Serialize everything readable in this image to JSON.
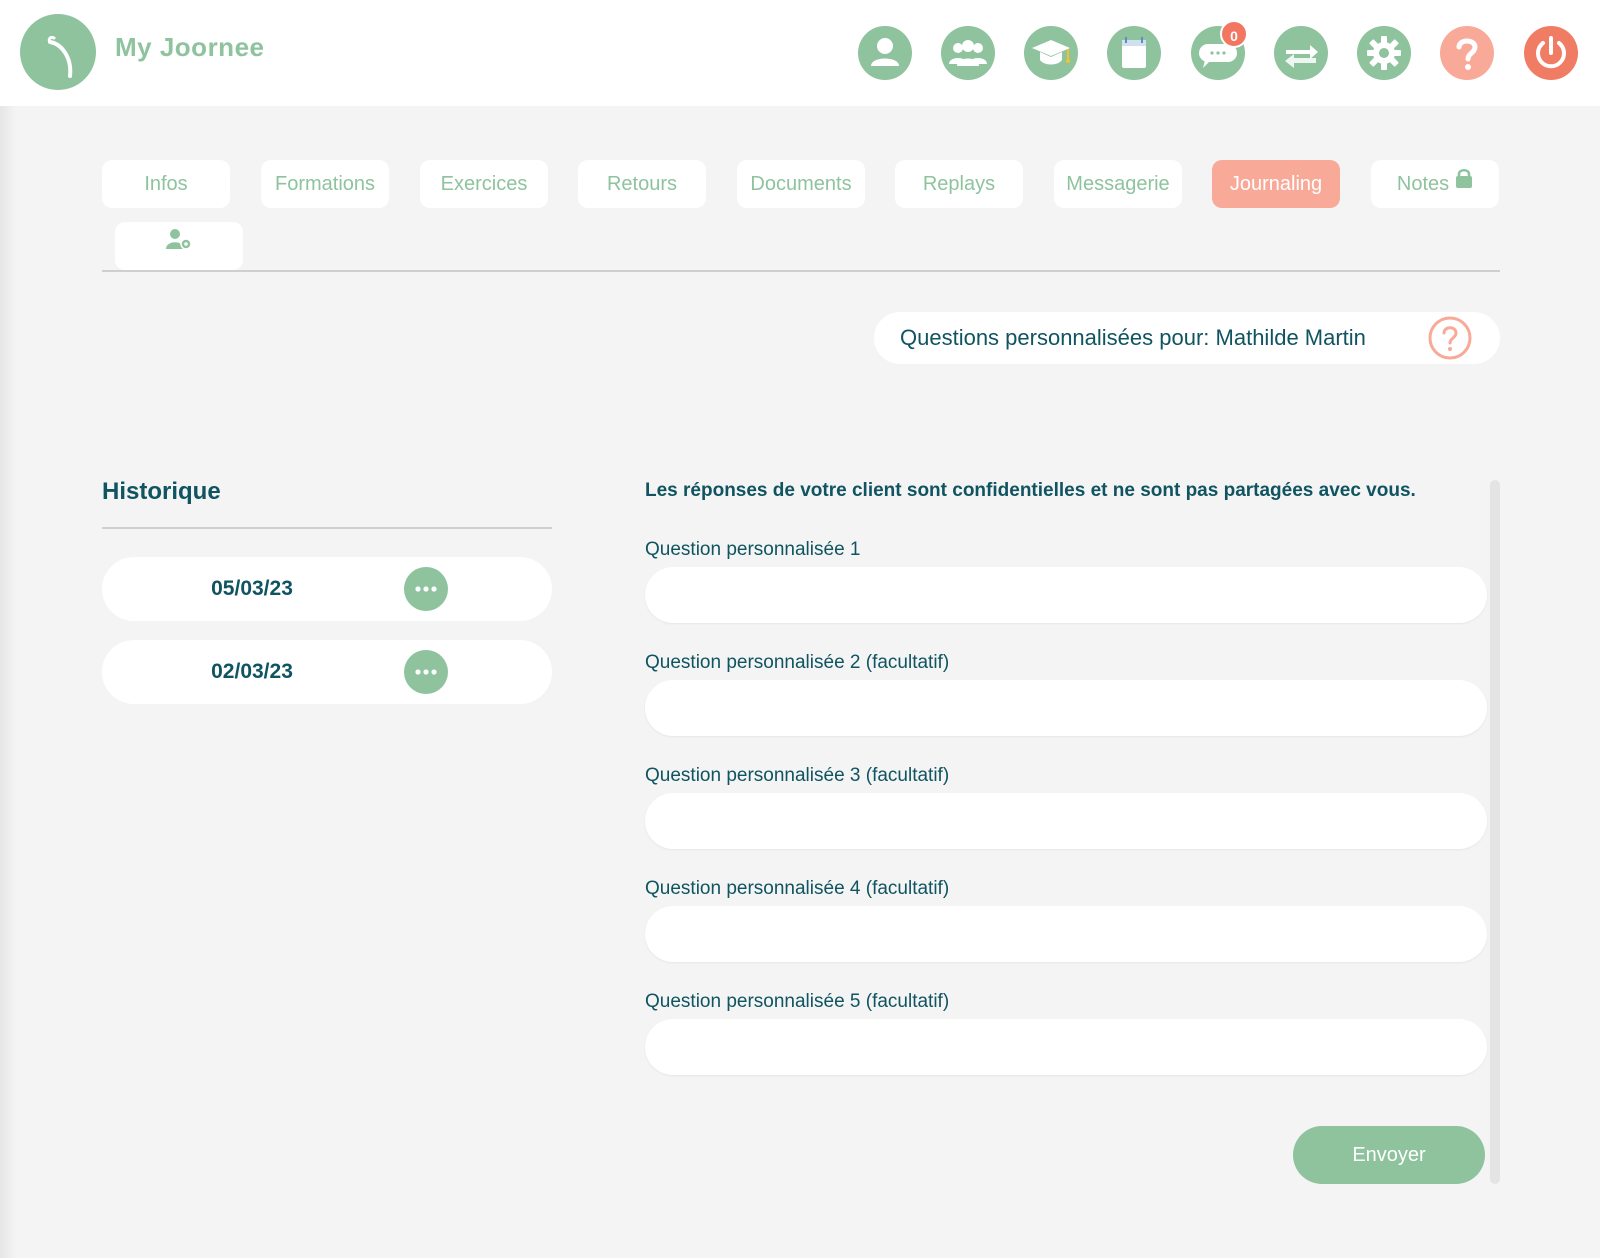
{
  "app": {
    "title": "My Joornee"
  },
  "header": {
    "icons": [
      {
        "name": "profile-icon"
      },
      {
        "name": "group-icon"
      },
      {
        "name": "graduation-cap-icon"
      },
      {
        "name": "calendar-icon"
      },
      {
        "name": "chat-icon",
        "badge": "0"
      },
      {
        "name": "sync-icon"
      },
      {
        "name": "gear-icon"
      },
      {
        "name": "help-icon"
      },
      {
        "name": "power-icon"
      }
    ]
  },
  "tabs": [
    {
      "label": "Infos"
    },
    {
      "label": "Formations"
    },
    {
      "label": "Exercices"
    },
    {
      "label": "Retours"
    },
    {
      "label": "Documents"
    },
    {
      "label": "Replays"
    },
    {
      "label": "Messagerie"
    },
    {
      "label": "Journaling",
      "active": true
    },
    {
      "label": "Notes",
      "icon": "lock-icon"
    },
    {
      "label": "",
      "icon": "user-settings-icon"
    }
  ],
  "client": {
    "label": "Questions personnalisées pour: Mathilde Martin"
  },
  "history": {
    "title": "Historique",
    "items": [
      {
        "date": "05/03/23"
      },
      {
        "date": "02/03/23"
      }
    ]
  },
  "form": {
    "notice": "Les réponses de votre client sont confidentielles et ne sont pas partagées avec vous.",
    "questions": [
      {
        "label": "Question personnalisée 1",
        "value": ""
      },
      {
        "label": "Question personnalisée 2 (facultatif)",
        "value": ""
      },
      {
        "label": "Question personnalisée 3 (facultatif)",
        "value": ""
      },
      {
        "label": "Question personnalisée 4 (facultatif)",
        "value": ""
      },
      {
        "label": "Question personnalisée 5 (facultatif)",
        "value": ""
      }
    ],
    "submit_label": "Envoyer"
  },
  "colors": {
    "green": "#8ec39e",
    "salmon": "#f9a998",
    "red": "#f17c64",
    "text": "#0f5460",
    "background": "#f4f4f4"
  }
}
